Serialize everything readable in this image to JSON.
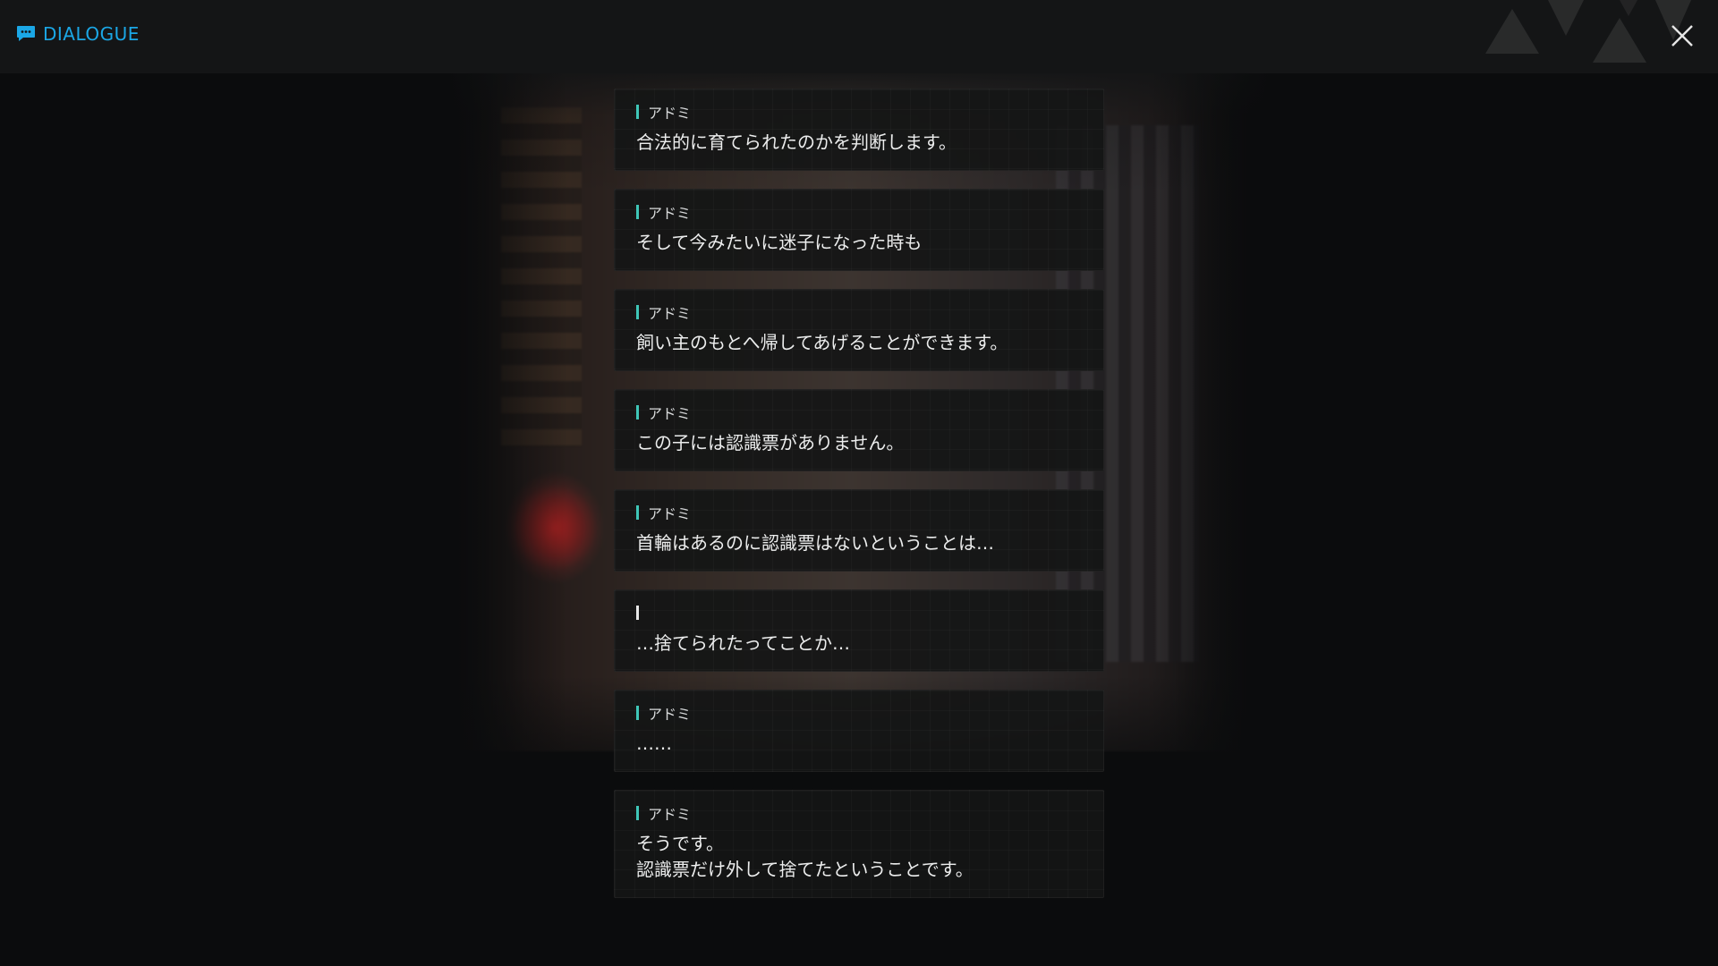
{
  "header": {
    "title": "DIALOGUE",
    "title_icon": "chat-bubble-icon",
    "close_icon": "close-icon",
    "accent_color": "#1ba7e6"
  },
  "dialogue": {
    "speaker_bar_color": "#3fc6b8",
    "entries": [
      {
        "speaker": "アドミ",
        "text": "合法的に育てられたのかを判断します。"
      },
      {
        "speaker": "アドミ",
        "text": "そして今みたいに迷子になった時も"
      },
      {
        "speaker": "アドミ",
        "text": "飼い主のもとへ帰してあげることができます。"
      },
      {
        "speaker": "アドミ",
        "text": "この子には認識票がありません。"
      },
      {
        "speaker": "アドミ",
        "text": "首輪はあるのに認識票はないということは…"
      },
      {
        "speaker": "",
        "text": "…捨てられたってことか…"
      },
      {
        "speaker": "アドミ",
        "text": "……"
      },
      {
        "speaker": "アドミ",
        "text": "そうです。\n認識票だけ外して捨てたということです。"
      }
    ]
  }
}
